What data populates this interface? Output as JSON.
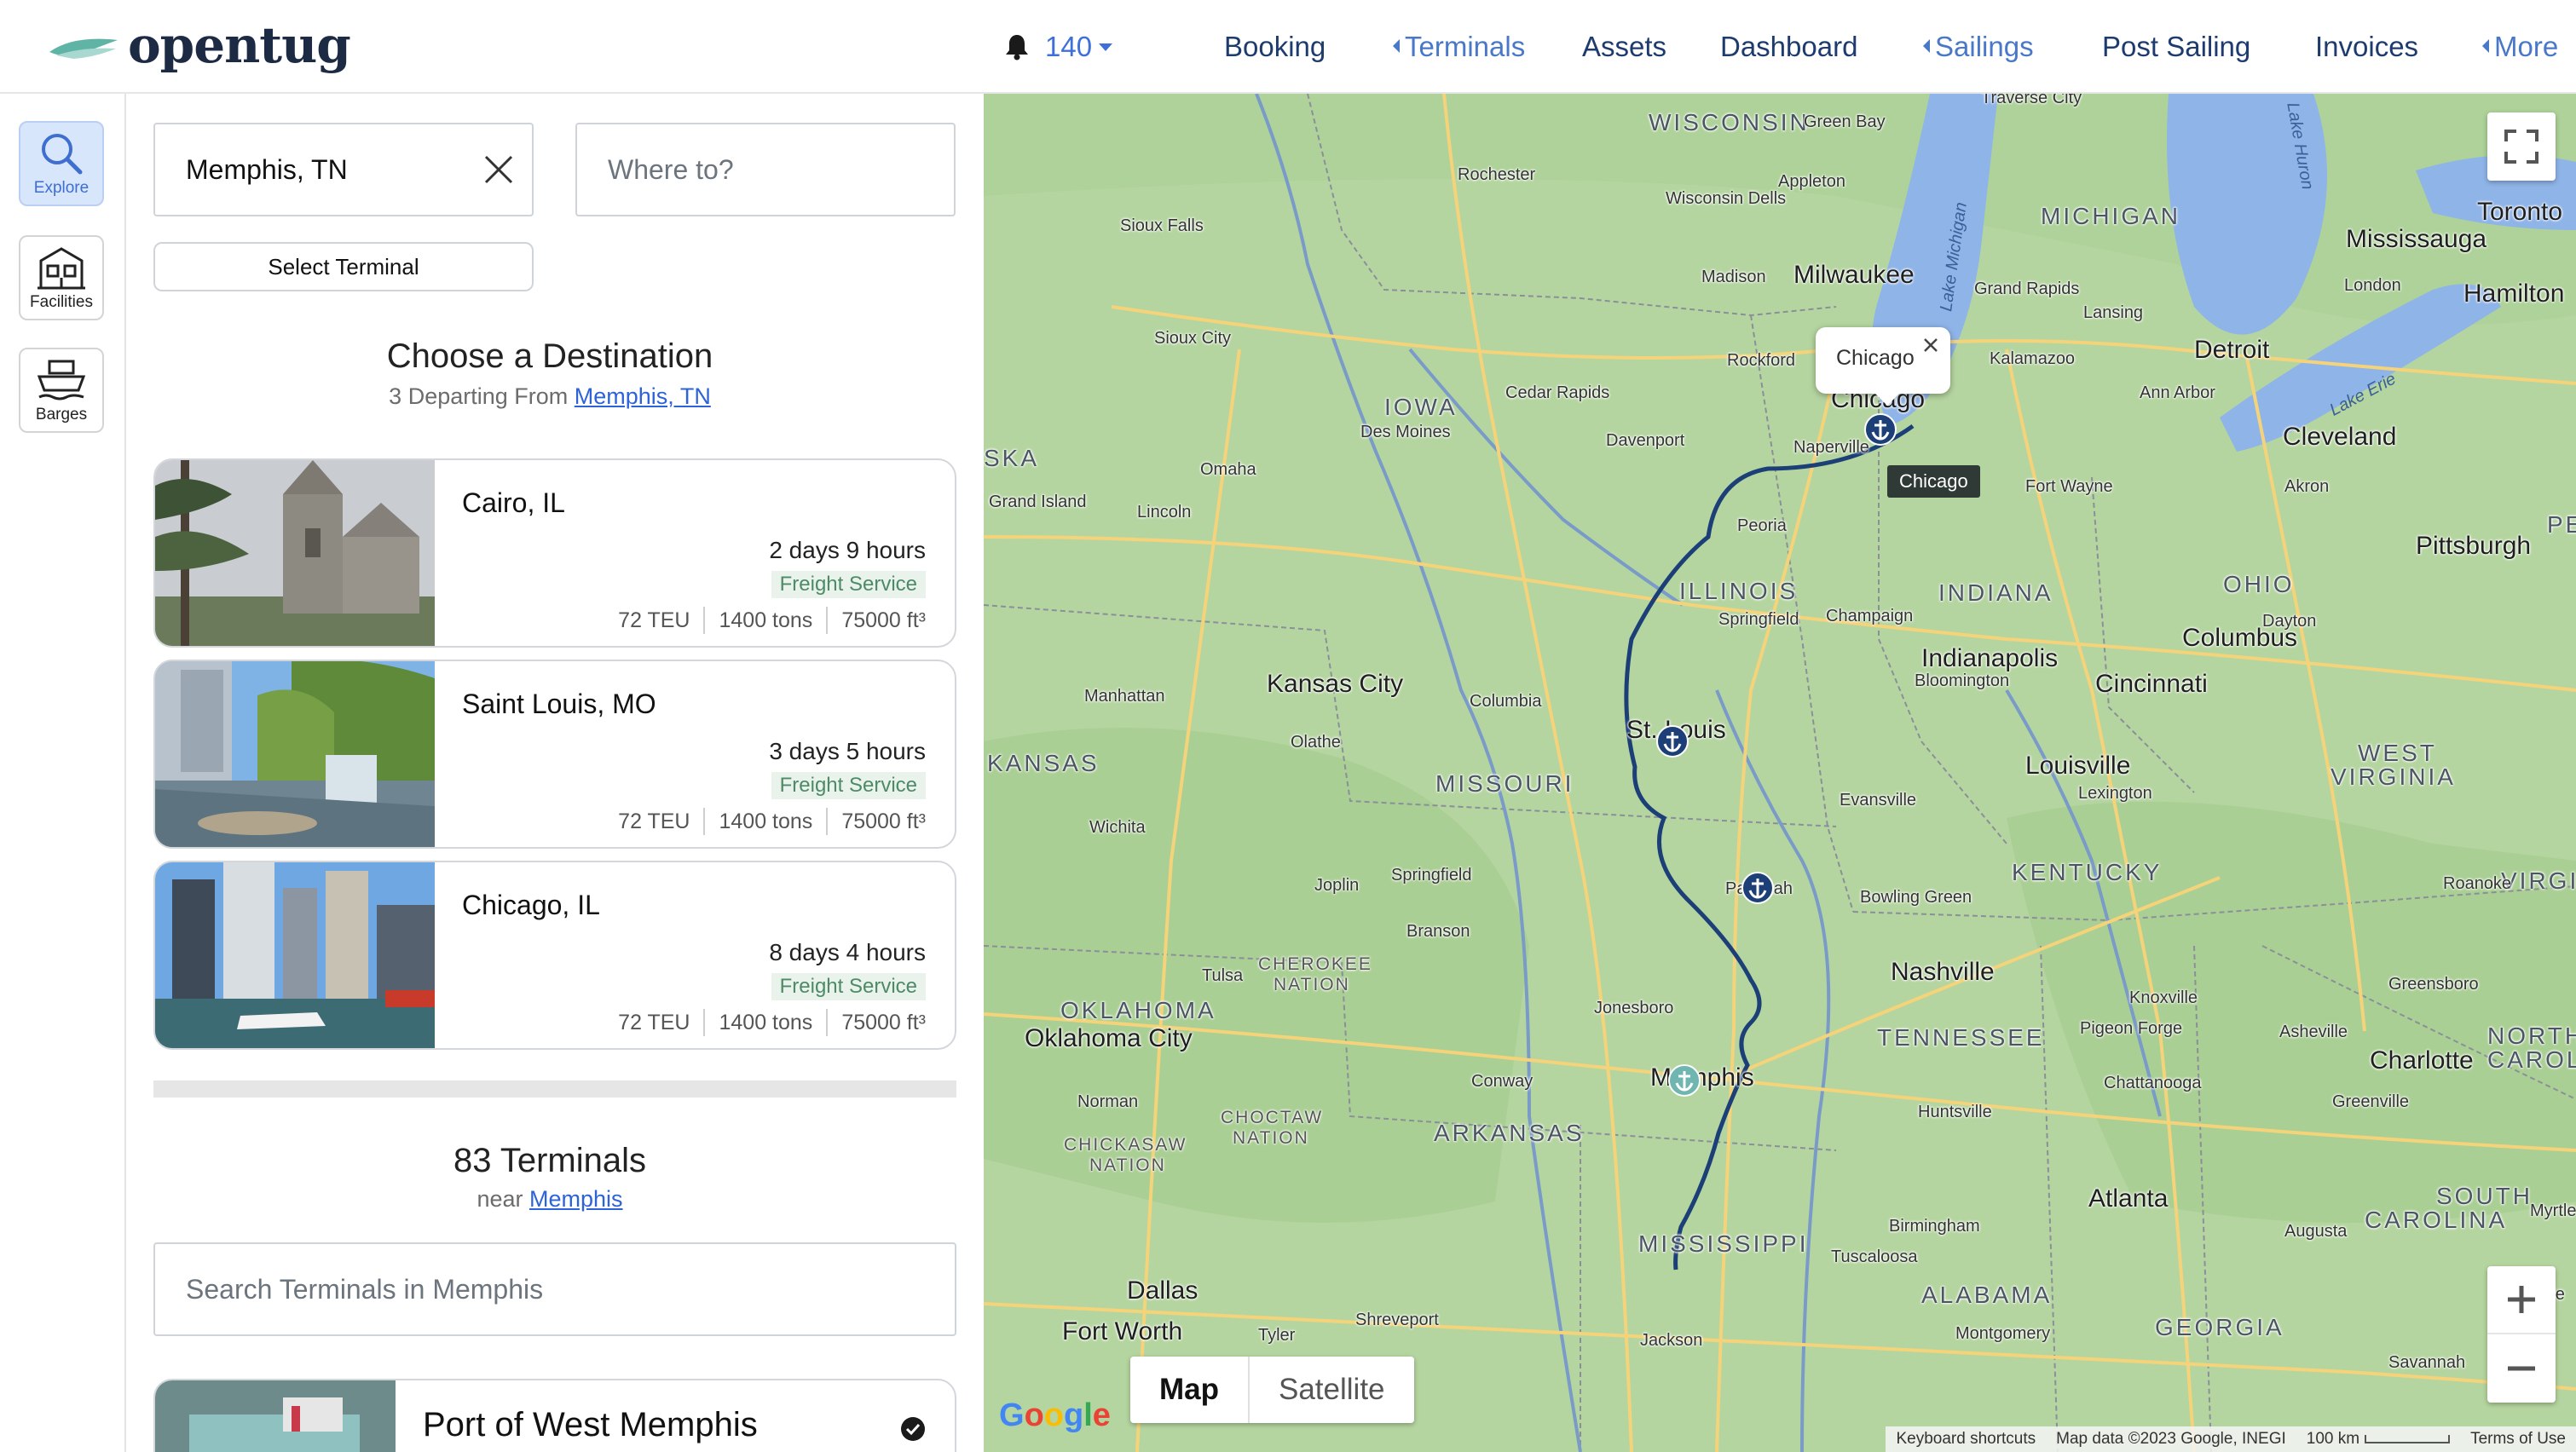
{
  "header": {
    "logo_text": "opentug",
    "notifications": {
      "icon": "bell-icon",
      "count": "140"
    },
    "nav": [
      {
        "label": "Booking",
        "submenu": false
      },
      {
        "label": "Terminals",
        "submenu": true
      },
      {
        "label": "Assets",
        "submenu": false
      },
      {
        "label": "Dashboard",
        "submenu": false
      },
      {
        "label": "Sailings",
        "submenu": true
      },
      {
        "label": "Post Sailing",
        "submenu": false
      },
      {
        "label": "Invoices",
        "submenu": false
      },
      {
        "label": "More",
        "submenu": true
      }
    ]
  },
  "rail": {
    "items": [
      {
        "label": "Explore",
        "icon": "search-icon",
        "active": true
      },
      {
        "label": "Facilities",
        "icon": "facility-icon",
        "active": false
      },
      {
        "label": "Barges",
        "icon": "barge-icon",
        "active": false
      }
    ]
  },
  "search": {
    "from_value": "Memphis, TN",
    "to_placeholder": "Where to?",
    "select_terminal_label": "Select Terminal"
  },
  "destinations": {
    "title": "Choose a Destination",
    "subtitle_prefix": "3 Departing From",
    "subtitle_link": "Memphis, TN",
    "items": [
      {
        "city": "Cairo, IL",
        "duration": "2 days 9 hours",
        "service": "Freight Service",
        "teu": "72 TEU",
        "tons": "1400 tons",
        "volume": "75000 ft³"
      },
      {
        "city": "Saint Louis, MO",
        "duration": "3 days 5 hours",
        "service": "Freight Service",
        "teu": "72 TEU",
        "tons": "1400 tons",
        "volume": "75000 ft³"
      },
      {
        "city": "Chicago, IL",
        "duration": "8 days 4 hours",
        "service": "Freight Service",
        "teu": "72 TEU",
        "tons": "1400 tons",
        "volume": "75000 ft³"
      }
    ]
  },
  "terminals": {
    "title": "83 Terminals",
    "subtitle_prefix": "near",
    "subtitle_link": "Memphis",
    "search_placeholder": "Search Terminals in Memphis",
    "first_item": "Port of West Memphis"
  },
  "map": {
    "info_window_text": "Chicago",
    "tooltip_text": "Chicago",
    "type_options": {
      "selected": "Map",
      "other": "Satellite"
    },
    "google_logo": "Google",
    "attribution": {
      "shortcuts": "Keyboard shortcuts",
      "data": "Map data ©2023 Google, INEGI",
      "scale": "100 km",
      "terms": "Terms of Use"
    },
    "colors": {
      "land": "#b7d6a4",
      "water": "#8fb4e8",
      "route": "#1c3f78",
      "road": "#f4d37a"
    },
    "states": [
      "WISCONSIN",
      "MICHIGAN",
      "IOWA",
      "ILLINOIS",
      "INDIANA",
      "OHIO",
      "KANSAS",
      "MISSOURI",
      "KENTUCKY",
      "WEST",
      "VIRGINIA",
      "TENNESSEE",
      "OKLAHOMA",
      "ARKANSAS",
      "MISSISSIPPI",
      "ALABAMA",
      "GEORGIA",
      "SOUTH",
      "CAROLINA",
      "NORTH",
      "CAROL",
      "VIRGI",
      "SKA",
      "PE",
      "CHEROKEE",
      "NATION",
      "CHOCTAW",
      "NATION",
      "CHICKASAW",
      "NATION"
    ],
    "big_cities": [
      "Milwaukee",
      "Chicago",
      "Detroit",
      "Cleveland",
      "Toronto",
      "Mississauga",
      "Hamilton",
      "Pittsburgh",
      "Columbus",
      "Indianapolis",
      "Cincinnati",
      "Louisville",
      "Kansas City",
      "St. Louis",
      "Nashville",
      "Memphis",
      "Oklahoma City",
      "Atlanta",
      "Charlotte",
      "Dallas",
      "Fort Worth"
    ],
    "cities": [
      "Green Bay",
      "Traverse City",
      "Rochester",
      "Sioux Falls",
      "Wisconsin Dells",
      "Appleton",
      "Madison",
      "Grand Rapids",
      "Lansing",
      "London",
      "Sioux City",
      "Rockford",
      "Kalamazoo",
      "Ann Arbor",
      "Cedar Rapids",
      "Des Moines",
      "Davenport",
      "Naperville",
      "Omaha",
      "Grand Island",
      "Lincoln",
      "Fort Wayne",
      "Akron",
      "Peoria",
      "Springfield",
      "Champaign",
      "Dayton",
      "Bloomington",
      "Manhattan",
      "Columbia",
      "Olathe",
      "Evansville",
      "Lexington",
      "Wichita",
      "Springfield",
      "Joplin",
      "Paducah",
      "Bowling Green",
      "Roanoke",
      "Branson",
      "Tulsa",
      "Knoxville",
      "Greensboro",
      "Jonesboro",
      "Pigeon Forge",
      "Asheville",
      "Norman",
      "Conway",
      "Chattanooga",
      "Greenville",
      "Huntsville",
      "Birmingham",
      "Tuscaloosa",
      "Augusta",
      "Myrtle B",
      "Shreveport",
      "Tyler",
      "Montgomery",
      "Jackson",
      "Charle",
      "Savannah"
    ],
    "water_labels": [
      "Lake Michigan",
      "Lake Huron",
      "Lake Erie"
    ]
  }
}
